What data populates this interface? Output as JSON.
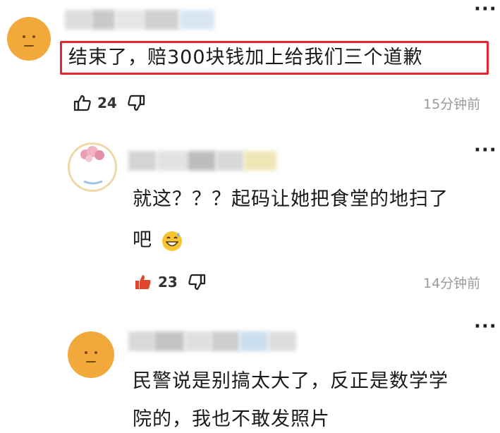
{
  "comments": [
    {
      "text": "结束了，赔300块钱加上给我们三个道歉",
      "likes": "24",
      "time": "15分钟前",
      "liked": false,
      "highlighted": true,
      "avatar": "smiley-face"
    },
    {
      "text_line1": "就这？？？起码让她把食堂的地扫了",
      "text_line2": "吧",
      "emoji": "grinning-sweat-emoji",
      "likes": "23",
      "time": "14分钟前",
      "liked": true,
      "avatar": "cherry-blossom-circle"
    },
    {
      "text_line1": "民警说是别搞太大了，反正是数学学",
      "text_line2": "院的，我也不敢发照片",
      "avatar": "smiley-face"
    }
  ],
  "colors": {
    "highlight_border": "#e8242c",
    "liked_thumb": "#e0452d",
    "avatar_orange": "#f2a93b",
    "time_gray": "#9a9a9a"
  }
}
